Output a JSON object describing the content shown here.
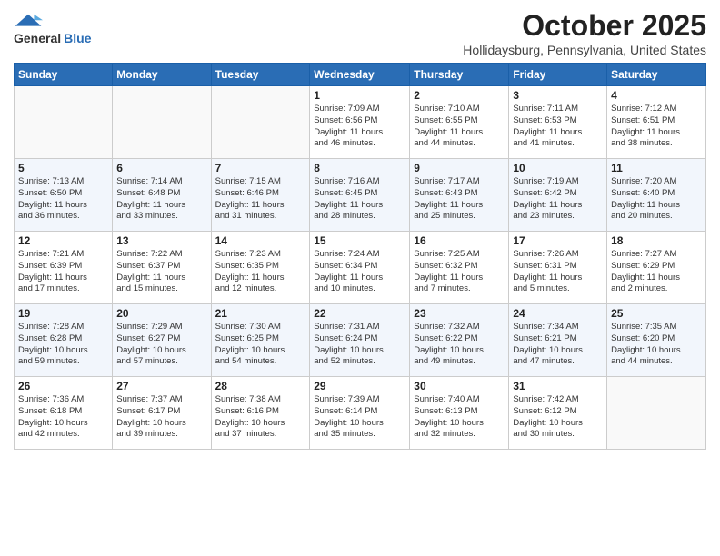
{
  "header": {
    "logo": {
      "general": "General",
      "blue": "Blue"
    },
    "title": "October 2025",
    "location": "Hollidaysburg, Pennsylvania, United States"
  },
  "calendar": {
    "weekdays": [
      "Sunday",
      "Monday",
      "Tuesday",
      "Wednesday",
      "Thursday",
      "Friday",
      "Saturday"
    ],
    "weeks": [
      [
        {
          "day": "",
          "info": ""
        },
        {
          "day": "",
          "info": ""
        },
        {
          "day": "",
          "info": ""
        },
        {
          "day": "1",
          "info": "Sunrise: 7:09 AM\nSunset: 6:56 PM\nDaylight: 11 hours\nand 46 minutes."
        },
        {
          "day": "2",
          "info": "Sunrise: 7:10 AM\nSunset: 6:55 PM\nDaylight: 11 hours\nand 44 minutes."
        },
        {
          "day": "3",
          "info": "Sunrise: 7:11 AM\nSunset: 6:53 PM\nDaylight: 11 hours\nand 41 minutes."
        },
        {
          "day": "4",
          "info": "Sunrise: 7:12 AM\nSunset: 6:51 PM\nDaylight: 11 hours\nand 38 minutes."
        }
      ],
      [
        {
          "day": "5",
          "info": "Sunrise: 7:13 AM\nSunset: 6:50 PM\nDaylight: 11 hours\nand 36 minutes."
        },
        {
          "day": "6",
          "info": "Sunrise: 7:14 AM\nSunset: 6:48 PM\nDaylight: 11 hours\nand 33 minutes."
        },
        {
          "day": "7",
          "info": "Sunrise: 7:15 AM\nSunset: 6:46 PM\nDaylight: 11 hours\nand 31 minutes."
        },
        {
          "day": "8",
          "info": "Sunrise: 7:16 AM\nSunset: 6:45 PM\nDaylight: 11 hours\nand 28 minutes."
        },
        {
          "day": "9",
          "info": "Sunrise: 7:17 AM\nSunset: 6:43 PM\nDaylight: 11 hours\nand 25 minutes."
        },
        {
          "day": "10",
          "info": "Sunrise: 7:19 AM\nSunset: 6:42 PM\nDaylight: 11 hours\nand 23 minutes."
        },
        {
          "day": "11",
          "info": "Sunrise: 7:20 AM\nSunset: 6:40 PM\nDaylight: 11 hours\nand 20 minutes."
        }
      ],
      [
        {
          "day": "12",
          "info": "Sunrise: 7:21 AM\nSunset: 6:39 PM\nDaylight: 11 hours\nand 17 minutes."
        },
        {
          "day": "13",
          "info": "Sunrise: 7:22 AM\nSunset: 6:37 PM\nDaylight: 11 hours\nand 15 minutes."
        },
        {
          "day": "14",
          "info": "Sunrise: 7:23 AM\nSunset: 6:35 PM\nDaylight: 11 hours\nand 12 minutes."
        },
        {
          "day": "15",
          "info": "Sunrise: 7:24 AM\nSunset: 6:34 PM\nDaylight: 11 hours\nand 10 minutes."
        },
        {
          "day": "16",
          "info": "Sunrise: 7:25 AM\nSunset: 6:32 PM\nDaylight: 11 hours\nand 7 minutes."
        },
        {
          "day": "17",
          "info": "Sunrise: 7:26 AM\nSunset: 6:31 PM\nDaylight: 11 hours\nand 5 minutes."
        },
        {
          "day": "18",
          "info": "Sunrise: 7:27 AM\nSunset: 6:29 PM\nDaylight: 11 hours\nand 2 minutes."
        }
      ],
      [
        {
          "day": "19",
          "info": "Sunrise: 7:28 AM\nSunset: 6:28 PM\nDaylight: 10 hours\nand 59 minutes."
        },
        {
          "day": "20",
          "info": "Sunrise: 7:29 AM\nSunset: 6:27 PM\nDaylight: 10 hours\nand 57 minutes."
        },
        {
          "day": "21",
          "info": "Sunrise: 7:30 AM\nSunset: 6:25 PM\nDaylight: 10 hours\nand 54 minutes."
        },
        {
          "day": "22",
          "info": "Sunrise: 7:31 AM\nSunset: 6:24 PM\nDaylight: 10 hours\nand 52 minutes."
        },
        {
          "day": "23",
          "info": "Sunrise: 7:32 AM\nSunset: 6:22 PM\nDaylight: 10 hours\nand 49 minutes."
        },
        {
          "day": "24",
          "info": "Sunrise: 7:34 AM\nSunset: 6:21 PM\nDaylight: 10 hours\nand 47 minutes."
        },
        {
          "day": "25",
          "info": "Sunrise: 7:35 AM\nSunset: 6:20 PM\nDaylight: 10 hours\nand 44 minutes."
        }
      ],
      [
        {
          "day": "26",
          "info": "Sunrise: 7:36 AM\nSunset: 6:18 PM\nDaylight: 10 hours\nand 42 minutes."
        },
        {
          "day": "27",
          "info": "Sunrise: 7:37 AM\nSunset: 6:17 PM\nDaylight: 10 hours\nand 39 minutes."
        },
        {
          "day": "28",
          "info": "Sunrise: 7:38 AM\nSunset: 6:16 PM\nDaylight: 10 hours\nand 37 minutes."
        },
        {
          "day": "29",
          "info": "Sunrise: 7:39 AM\nSunset: 6:14 PM\nDaylight: 10 hours\nand 35 minutes."
        },
        {
          "day": "30",
          "info": "Sunrise: 7:40 AM\nSunset: 6:13 PM\nDaylight: 10 hours\nand 32 minutes."
        },
        {
          "day": "31",
          "info": "Sunrise: 7:42 AM\nSunset: 6:12 PM\nDaylight: 10 hours\nand 30 minutes."
        },
        {
          "day": "",
          "info": ""
        }
      ]
    ]
  }
}
